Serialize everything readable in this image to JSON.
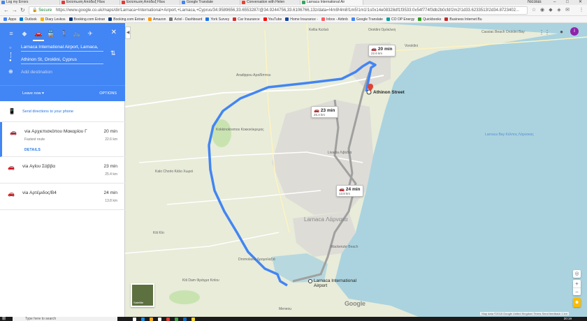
{
  "browser": {
    "tabs": [
      {
        "label": "Log my Errors",
        "color": "#4285f4"
      },
      {
        "label": "Εκτύπωση Απόδειξ Ηλεκ",
        "color": "#e53935"
      },
      {
        "label": "Εκτύπωση Απόδειξ Ηλεκ",
        "color": "#e53935"
      },
      {
        "label": "Google Translate",
        "color": "#4285f4"
      },
      {
        "label": "Conversation with Helen",
        "color": "#ea4335"
      },
      {
        "label": "Larnaca International Air",
        "color": "#34a853"
      }
    ],
    "window_user": "Nicolas",
    "secure_label": "Secure",
    "url": "https://www.google.co.uk/maps/dir/Larnaca+International+Airport,+Larnaca,+Cyprus/34.9589656,33.6553287/@34.9244756,33.6106766,13z/data=!4m9!4m8!1m5!1m1!1s0x14e08328df1f3533:0x54f774f3db2b0cfd!2m2!1d33.6233513!2d34.8723402..."
  },
  "bookmarks": [
    {
      "label": "Apps",
      "color": "#4285f4"
    },
    {
      "label": "Outlook",
      "color": "#0078d4"
    },
    {
      "label": "Diary Levkos",
      "color": "#f4b400"
    },
    {
      "label": "Booking.com Extran",
      "color": "#003580"
    },
    {
      "label": "Booking.com Extran",
      "color": "#003580"
    },
    {
      "label": "Amazon",
      "color": "#ff9900"
    },
    {
      "label": "Actel - Dashboard",
      "color": "#777777"
    },
    {
      "label": "York Survey",
      "color": "#1a73e8"
    },
    {
      "label": "Car Insurance",
      "color": "#d32f2f"
    },
    {
      "label": "YouTube",
      "color": "#ff0000"
    },
    {
      "label": "Home Insurance -",
      "color": "#0d47a1"
    },
    {
      "label": "Inbox - Airbnb",
      "color": "#ff5a5f"
    },
    {
      "label": "Google Translate",
      "color": "#4285f4"
    },
    {
      "label": "CO OP Energy",
      "color": "#00a0a0"
    },
    {
      "label": "Quickbooks",
      "color": "#2ca01c"
    },
    {
      "label": "Business Internet Bu",
      "color": "#c62828"
    }
  ],
  "panel": {
    "origin": "Larnaca International Airport, Larnaca,",
    "destination": "Athinon St, Oroklini, Cyprus",
    "add_destination": "Add destination",
    "leave_now": "Leave now",
    "options": "OPTIONS",
    "send_directions": "Send directions to your phone",
    "routes": [
      {
        "name": "via Αρχιεπισκόπου Μακαρίου Γ",
        "duration": "20 min",
        "distance": "22.6 km",
        "sub": "Fastest route",
        "details": "DETAILS"
      },
      {
        "name": "via Αγίου Σάββα",
        "duration": "23 min",
        "distance": "25.4 km"
      },
      {
        "name": "via Αρτέμιδος/B4",
        "duration": "24 min",
        "distance": "13.8 km"
      }
    ]
  },
  "map": {
    "badges": [
      {
        "time": "20 min",
        "dist": "22.6 km"
      },
      {
        "time": "23 min",
        "dist": "25.4 km"
      },
      {
        "time": "24 min",
        "dist": "13.8 km"
      }
    ],
    "destination_label": "Athinon Street",
    "airport_label": "Larnaca International Airport",
    "city_label": "Larnaca Λάρνακα",
    "labels": {
      "oroklini": "Oroklini Ορόκλινη",
      "kellia": "Kellia Κελλιά",
      "aradippou": "Aradippou Αραδίππου",
      "livadia": "Livadia Λιβάδια",
      "kiti": "Kiti Κίτι",
      "kokkinokremos": "Kokkinokremos Κοκκινόκρεμος",
      "dromolaxia": "Dromolaxia Δρομολαξιά",
      "kalo_chorio": "Kalo Chorio Κάλο Χωριό",
      "kiti_dam": "Kiti Dam Φράγμα Κιτίου",
      "larnaca_bay": "Larnaca Bay Κόλπος Λάρνακας",
      "cassiac_beach": "Cassiac Beach Oroklini Bay",
      "mackenzie_beach": "Mackenzie Beach",
      "meneou": "Meneou",
      "voroklini": "Voroklini"
    },
    "satellite_label": "Satellite",
    "attribution": "Map data ©2018 Google   United Kingdom   Terms   Send feedback   1 km",
    "zoom_in": "+",
    "zoom_out": "−",
    "google": "Google",
    "avatar_initial": "i",
    "colors": {
      "route": "#4285f4",
      "alt_route": "#a0a0a0",
      "sea": "#aad3df",
      "land": "#e8ecd9",
      "pin": "#db4437"
    }
  },
  "taskbar": {
    "search_placeholder": "Type here to search",
    "time": "20:19"
  }
}
